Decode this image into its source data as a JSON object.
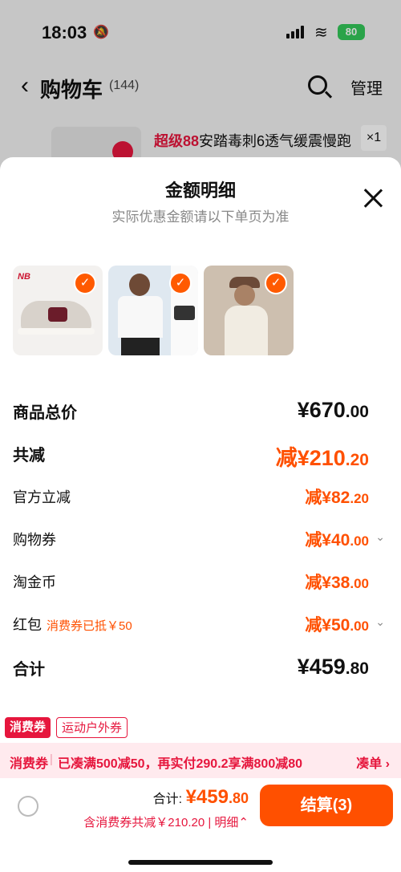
{
  "status": {
    "time": "18:03",
    "battery": "80"
  },
  "nav": {
    "back": "‹",
    "title": "购物车",
    "count": "(144)",
    "manage": "管理"
  },
  "bg_item": {
    "tag": "超级88",
    "title": "安踏毒刺6透气缓震慢跑",
    "qty": "×1"
  },
  "sheet": {
    "title": "金额明细",
    "subtitle": "实际优惠金额请以下单页为准",
    "items": [
      {
        "name": "new-balance-shoe",
        "checked": true
      },
      {
        "name": "anta-tshirt",
        "checked": true
      },
      {
        "name": "womens-coat",
        "checked": true
      }
    ],
    "nb_logo": "NB",
    "rows": {
      "goods_total": {
        "label": "商品总价",
        "main": "¥670",
        "dec": ".00"
      },
      "total_reduce": {
        "label": "共减",
        "main": "减¥210",
        "dec": ".20"
      },
      "official": {
        "label": "官方立减",
        "main": "减¥82",
        "dec": ".20"
      },
      "coupon": {
        "label": "购物券",
        "main": "减¥40",
        "dec": ".00"
      },
      "coins": {
        "label": "淘金币",
        "main": "减¥38",
        "dec": ".00"
      },
      "red_packet": {
        "label": "红包",
        "note": "消费券已抵￥50",
        "main": "减¥50",
        "dec": ".00"
      },
      "sum": {
        "label": "合计",
        "main": "¥459",
        "dec": ".80"
      }
    }
  },
  "tags": {
    "consume": "消费券",
    "outdoor": "运动户外券"
  },
  "promo": {
    "label": "消费券",
    "text": "已凑满500减50，再实付290.2享满800减80",
    "action": "凑单 ›"
  },
  "bottom": {
    "total_label": "合计:",
    "total_main": "¥459",
    "total_dec": ".80",
    "sub": "含消费券共减￥210.20",
    "detail": "明细⌃",
    "pay": "结算(3)"
  },
  "colors": {
    "accent": "#ff5000",
    "red": "#e6163d"
  }
}
